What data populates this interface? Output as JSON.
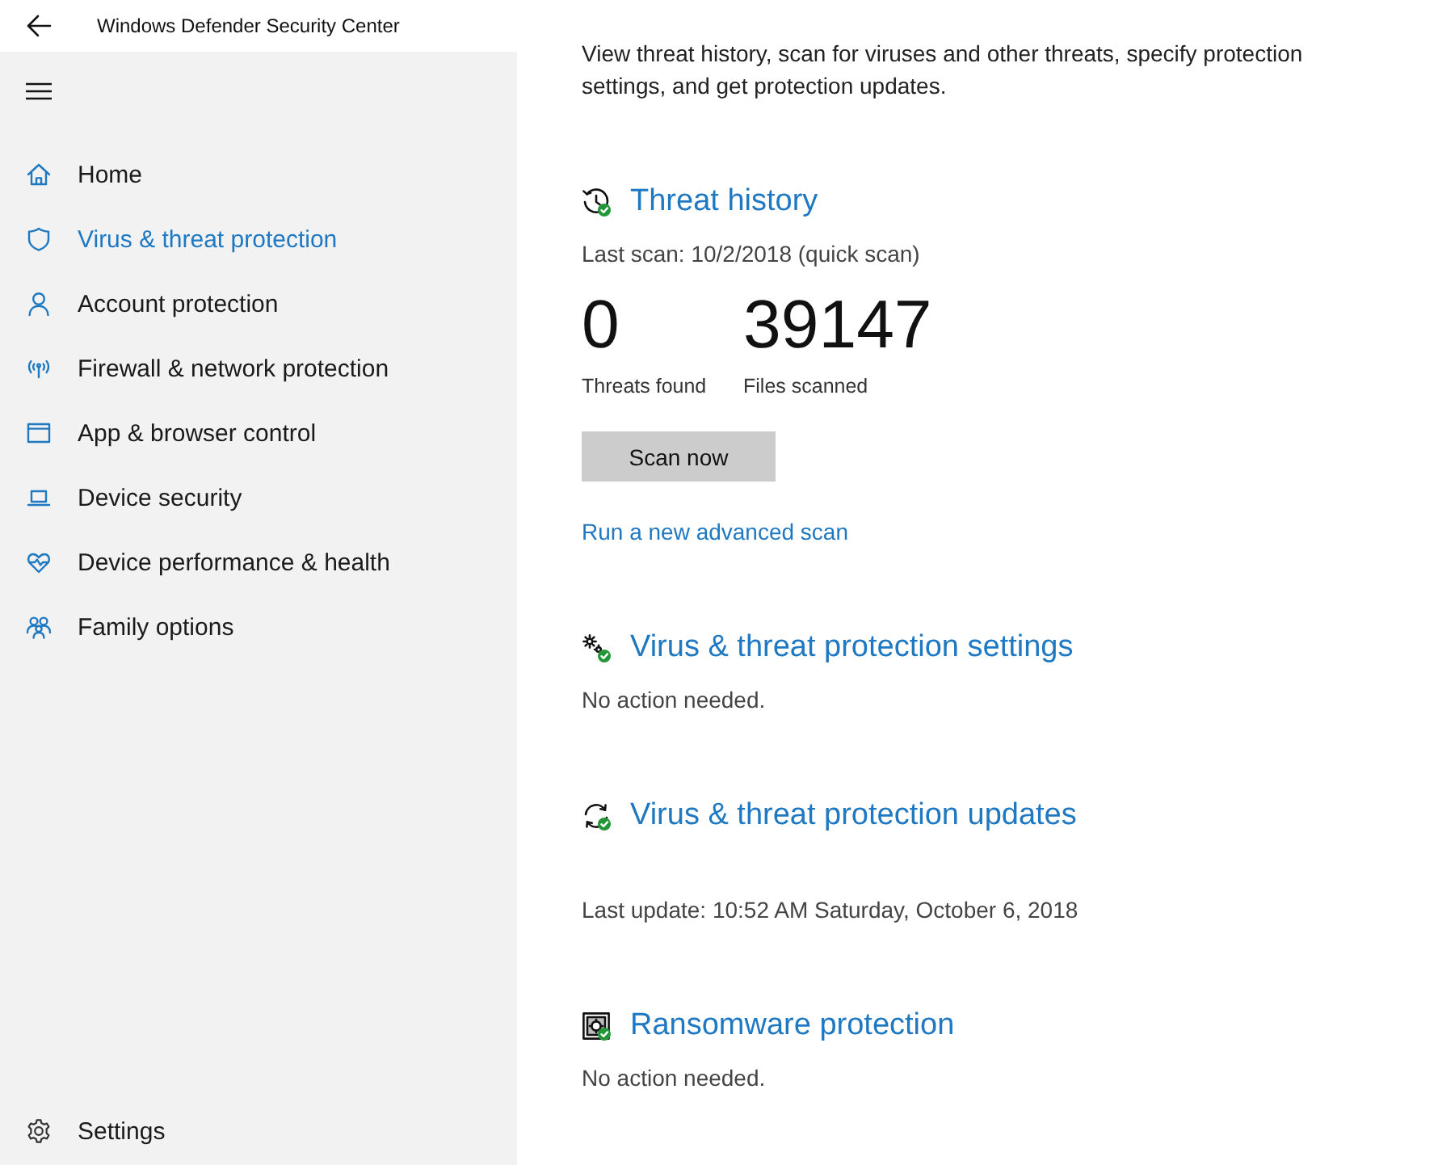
{
  "window": {
    "title": "Windows Defender Security Center"
  },
  "sidebar": {
    "items": [
      {
        "label": "Home",
        "selected": false
      },
      {
        "label": "Virus & threat protection",
        "selected": true
      },
      {
        "label": "Account protection",
        "selected": false
      },
      {
        "label": "Firewall & network protection",
        "selected": false
      },
      {
        "label": "App & browser control",
        "selected": false
      },
      {
        "label": "Device security",
        "selected": false
      },
      {
        "label": "Device performance & health",
        "selected": false
      },
      {
        "label": "Family options",
        "selected": false
      }
    ],
    "footer": {
      "label": "Settings"
    }
  },
  "main": {
    "intro": "View threat history, scan for viruses and other threats, specify protection settings, and get protection updates.",
    "sections": [
      {
        "kind": "history",
        "title": "Threat history",
        "last_scan": "Last scan: 10/2/2018 (quick scan)",
        "stats": [
          {
            "value": "0",
            "label": "Threats found"
          },
          {
            "value": "39147",
            "label": "Files scanned"
          }
        ],
        "button": "Scan now",
        "link": "Run a new advanced scan"
      },
      {
        "kind": "status",
        "title": "Virus & threat protection settings",
        "status": "No action needed."
      },
      {
        "kind": "update",
        "title": "Virus & threat protection updates",
        "detail": "Last update: 10:52 AM Saturday, October 6, 2018"
      },
      {
        "kind": "status",
        "title": "Ransomware protection",
        "status": "No action needed."
      }
    ]
  }
}
